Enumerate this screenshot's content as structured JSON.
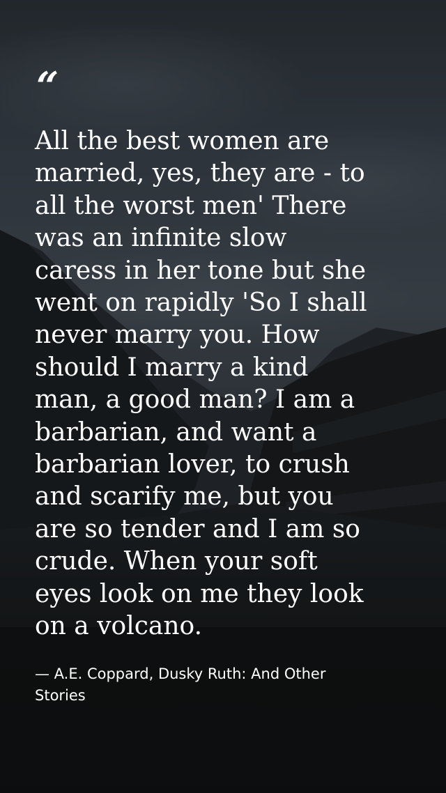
{
  "background": {
    "description_icon": "mountain-landscape-background",
    "sky_color": "#3d4650",
    "ground_color": "#17191b"
  },
  "quote": {
    "mark": "“",
    "lines": [
      "All the best women are",
      "married, yes, they are - to",
      "all the worst men' There",
      "was an infinite slow",
      "caress in her tone but she",
      "went on rapidly 'So I shall",
      "never marry you. How",
      "should I marry a kind",
      "man, a good man? I am a",
      "barbarian, and want a",
      "barbarian lover, to crush",
      "and scarify me, but you",
      "are so tender and I am so",
      "crude. When your soft",
      "eyes look on me they look",
      "on a volcano."
    ]
  },
  "attribution": {
    "lines": [
      "— A.E. Coppard, Dusky Ruth: And Other",
      "Stories"
    ]
  }
}
